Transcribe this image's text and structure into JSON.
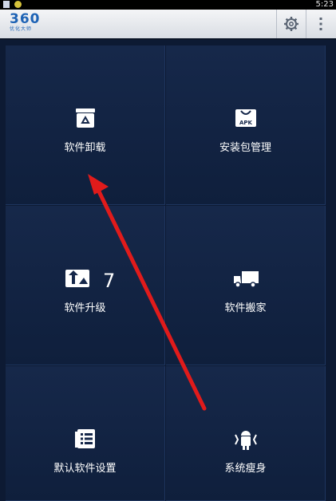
{
  "status_bar": {
    "time": "5:23"
  },
  "title_bar": {
    "logo_text": "360",
    "logo_subtext": "优化大师",
    "settings_icon": "gear-icon",
    "menu_icon": "overflow-menu-icon"
  },
  "tiles": [
    {
      "label": "软件卸载",
      "icon": "recycle-bin-icon"
    },
    {
      "label": "安装包管理",
      "icon": "apk-package-icon"
    },
    {
      "label": "软件升级",
      "icon": "upgrade-icon",
      "badge": "7"
    },
    {
      "label": "软件搬家",
      "icon": "truck-icon"
    },
    {
      "label": "默认软件设置",
      "icon": "list-document-icon"
    },
    {
      "label": "系统瘦身",
      "icon": "android-slim-icon"
    }
  ],
  "colors": {
    "background": "#0d1a33",
    "tile": "#15274a",
    "logo": "#1e63b5",
    "annotation_arrow": "#e01b1b"
  }
}
